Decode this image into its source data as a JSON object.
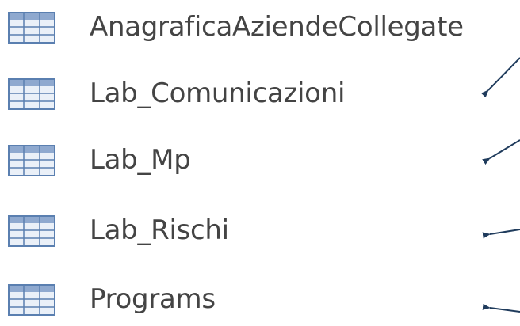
{
  "tables": [
    {
      "label": "AnagraficaAziendeCollegate",
      "icon": "table-icon",
      "arrow": false
    },
    {
      "label": "Lab_Comunicazioni",
      "icon": "table-icon",
      "arrow": true
    },
    {
      "label": "Lab_Mp",
      "icon": "table-icon",
      "arrow": true
    },
    {
      "label": "Lab_Rischi",
      "icon": "table-icon",
      "arrow": true
    },
    {
      "label": "Programs",
      "icon": "table-icon",
      "arrow": true
    }
  ],
  "colors": {
    "label_text": "#444444",
    "arrow": "#1f3b5c",
    "icon_frame": "#5a7fb0",
    "icon_header": "#8fa9cf",
    "icon_cell": "#eaf0f8"
  }
}
